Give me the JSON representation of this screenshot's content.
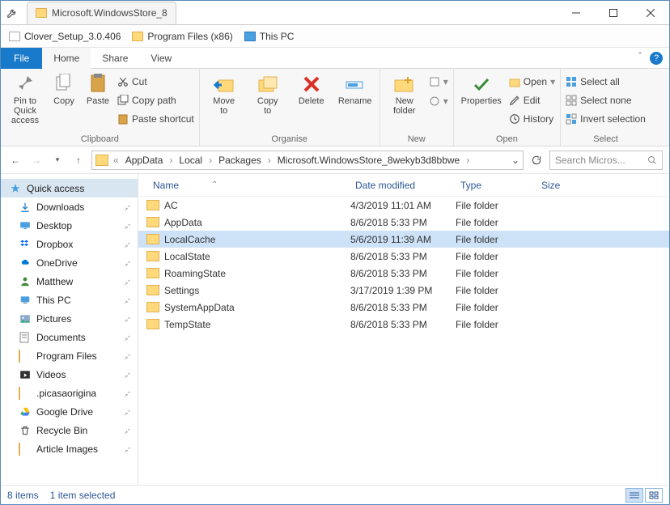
{
  "window": {
    "title": "Microsoft.WindowsStore_8"
  },
  "bookmarks": [
    {
      "label": "Clover_Setup_3.0.406",
      "kind": "doc"
    },
    {
      "label": "Program Files (x86)",
      "kind": "folder"
    },
    {
      "label": "This PC",
      "kind": "pc"
    }
  ],
  "ribbonTabs": {
    "file": "File",
    "home": "Home",
    "share": "Share",
    "view": "View"
  },
  "ribbon": {
    "clipboard": {
      "pin": "Pin to Quick\naccess",
      "copy": "Copy",
      "paste": "Paste",
      "cut": "Cut",
      "copyPath": "Copy path",
      "pasteShortcut": "Paste shortcut",
      "label": "Clipboard"
    },
    "organise": {
      "moveTo": "Move\nto",
      "copyTo": "Copy\nto",
      "delete": "Delete",
      "rename": "Rename",
      "label": "Organise"
    },
    "new": {
      "newFolder": "New\nfolder",
      "label": "New"
    },
    "open": {
      "properties": "Properties",
      "open": "Open",
      "edit": "Edit",
      "history": "History",
      "label": "Open"
    },
    "select": {
      "all": "Select all",
      "none": "Select none",
      "invert": "Invert selection",
      "label": "Select"
    }
  },
  "breadcrumb": [
    "AppData",
    "Local",
    "Packages",
    "Microsoft.WindowsStore_8wekyb3d8bbwe"
  ],
  "search": {
    "placeholder": "Search Micros..."
  },
  "columns": {
    "name": "Name",
    "date": "Date modified",
    "type": "Type",
    "size": "Size"
  },
  "sidebar": {
    "header": "Quick access",
    "items": [
      {
        "label": "Downloads",
        "icon": "download"
      },
      {
        "label": "Desktop",
        "icon": "desktop"
      },
      {
        "label": "Dropbox",
        "icon": "dropbox"
      },
      {
        "label": "OneDrive",
        "icon": "onedrive"
      },
      {
        "label": "Matthew",
        "icon": "user"
      },
      {
        "label": "This PC",
        "icon": "pc"
      },
      {
        "label": "Pictures",
        "icon": "pictures"
      },
      {
        "label": "Documents",
        "icon": "documents"
      },
      {
        "label": "Program Files",
        "icon": "folder"
      },
      {
        "label": "Videos",
        "icon": "videos"
      },
      {
        "label": ".picasaorigina",
        "icon": "folder"
      },
      {
        "label": "Google Drive",
        "icon": "gdrive"
      },
      {
        "label": "Recycle Bin",
        "icon": "recycle"
      },
      {
        "label": "Article Images",
        "icon": "folder"
      }
    ]
  },
  "files": [
    {
      "name": "AC",
      "date": "4/3/2019 11:01 AM",
      "type": "File folder",
      "selected": false
    },
    {
      "name": "AppData",
      "date": "8/6/2018 5:33 PM",
      "type": "File folder",
      "selected": false
    },
    {
      "name": "LocalCache",
      "date": "5/6/2019 11:39 AM",
      "type": "File folder",
      "selected": true
    },
    {
      "name": "LocalState",
      "date": "8/6/2018 5:33 PM",
      "type": "File folder",
      "selected": false
    },
    {
      "name": "RoamingState",
      "date": "8/6/2018 5:33 PM",
      "type": "File folder",
      "selected": false
    },
    {
      "name": "Settings",
      "date": "3/17/2019 1:39 PM",
      "type": "File folder",
      "selected": false
    },
    {
      "name": "SystemAppData",
      "date": "8/6/2018 5:33 PM",
      "type": "File folder",
      "selected": false
    },
    {
      "name": "TempState",
      "date": "8/6/2018 5:33 PM",
      "type": "File folder",
      "selected": false
    }
  ],
  "status": {
    "count": "8 items",
    "selected": "1 item selected"
  }
}
